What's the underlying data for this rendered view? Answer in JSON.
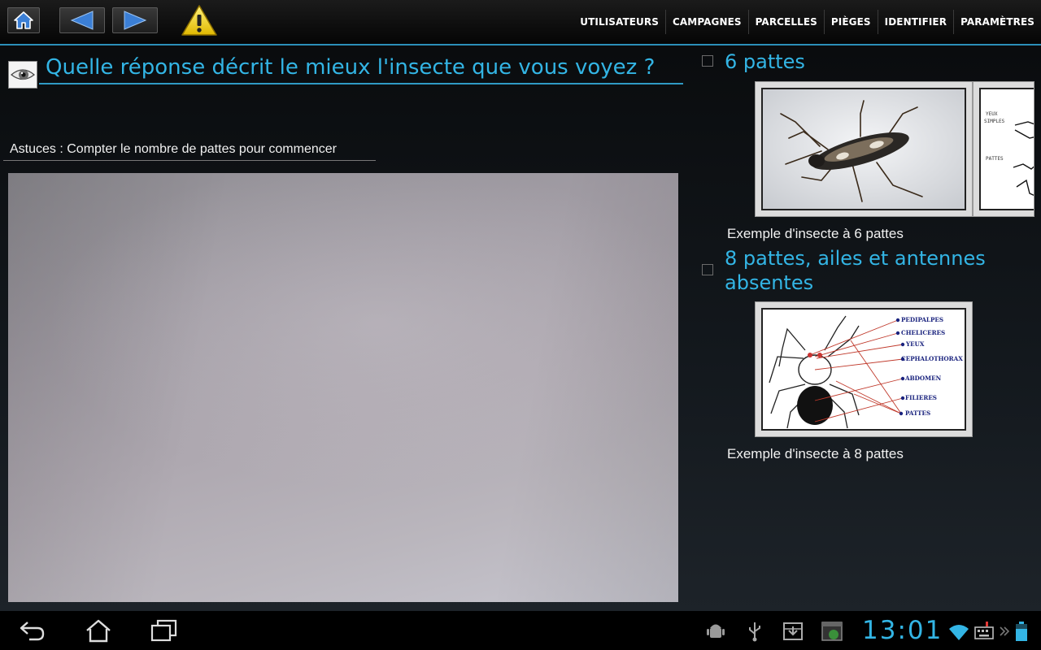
{
  "actionbar": {
    "home_icon": "home-icon",
    "back_icon": "arrow-left-icon",
    "forward_icon": "arrow-right-icon",
    "warning_icon": "warning-icon",
    "menu": [
      "UTILISATEURS",
      "CAMPAGNES",
      "PARCELLES",
      "PIÈGES",
      "IDENTIFIER",
      "PARAMÈTRES"
    ],
    "accent": "#33b5e5"
  },
  "question": {
    "text": "Quelle réponse décrit le mieux l'insecte que vous voyez ?",
    "icon": "eye-icon"
  },
  "hint": "Astuces : Compter le nombre de pattes pour commencer",
  "options": [
    {
      "label": "6 pattes",
      "caption": "Exemple d'insecte à 6 pattes",
      "diagram_labels": [
        "YEUX",
        "SIMPLES",
        "PATTES"
      ]
    },
    {
      "label": "8 pattes, ailes et antennes absentes",
      "caption": "Exemple d'insecte à 8 pattes",
      "diagram_labels": [
        "PEDIPALPES",
        "CHELICERES",
        "YEUX",
        "CEPHALOTHORAX",
        "ABDOMEN",
        "FILIERES",
        "PATTES"
      ]
    }
  ],
  "statusbar": {
    "time": "13:01",
    "nav_icons": [
      "back-icon",
      "home-icon",
      "recent-apps-icon"
    ],
    "status_icons": [
      "android-debug-icon",
      "usb-icon",
      "download-icon",
      "screenshot-icon",
      "wifi-icon",
      "keyboard-icon",
      "battery-icon"
    ]
  }
}
